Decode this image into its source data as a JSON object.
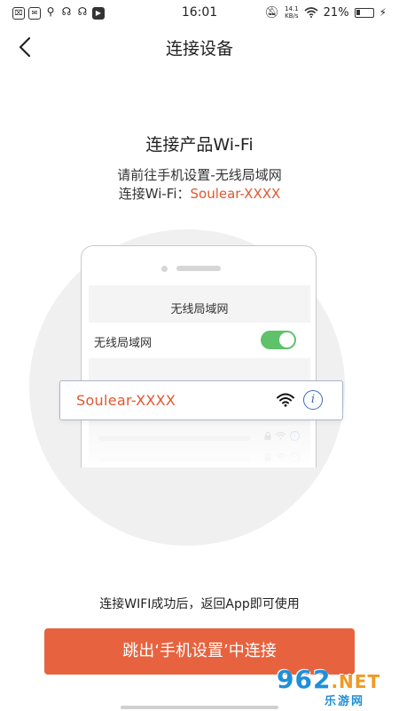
{
  "status_bar": {
    "time": "16:01",
    "left_icons": [
      "sim-icon",
      "message-icon",
      "usb-icon",
      "telecom-icon",
      "telecom-icon",
      "video-icon"
    ],
    "net_speed_value": "14.1",
    "net_speed_unit": "KB/s",
    "battery_percent": "21%"
  },
  "header": {
    "title": "连接设备",
    "back_icon": "chevron-left-icon"
  },
  "instructions": {
    "title": "连接产品Wi-Fi",
    "line1": "请前往手机设置-无线局域网",
    "line2_prefix": "连接Wi-Fi：",
    "line2_ssid": "Soulear-XXXX"
  },
  "illustration": {
    "screen_title": "无线局域网",
    "wlan_label": "无线局域网",
    "wlan_toggle_on": true,
    "network_name": "Soulear-XXXX",
    "info_glyph": "i",
    "colors": {
      "toggle": "#5fc26a",
      "ssid": "#e0572f",
      "info": "#3a6bc4"
    }
  },
  "footer": {
    "hint": "连接WIFI成功后，返回App即可使用",
    "button_label": "跳出‘手机设置’中连接",
    "button_color": "#e7633f"
  },
  "watermark": {
    "number": "962",
    "suffix": ".NET",
    "site_name": "乐游网"
  }
}
